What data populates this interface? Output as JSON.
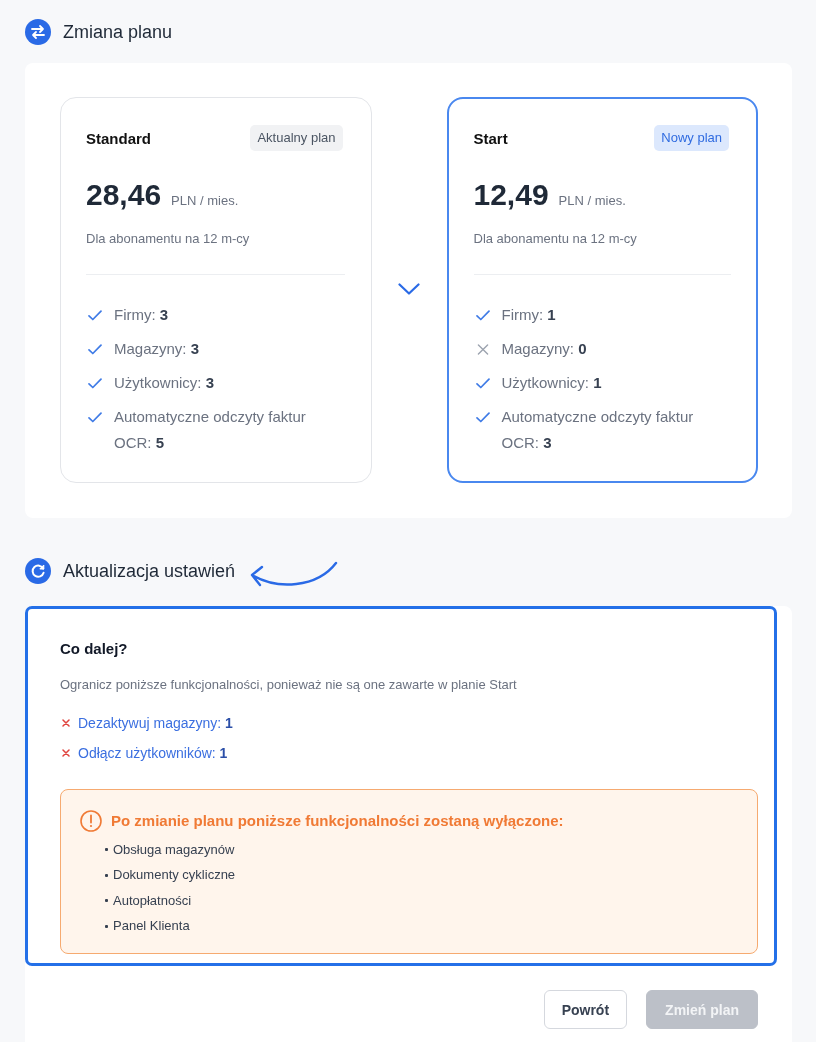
{
  "plan_change": {
    "title": "Zmiana planu",
    "plans": [
      {
        "name": "Standard",
        "badge": "Aktualny plan",
        "selected": false,
        "price": "28,46",
        "unit": "PLN / mies.",
        "note": "Dla abonamentu na 12 m-cy",
        "features": [
          {
            "text": "Firmy: **3**",
            "included": true
          },
          {
            "text": "Magazyny: **3**",
            "included": true
          },
          {
            "text": "Użytkownicy: **3**",
            "included": true
          },
          {
            "text": "Automatyczne odczyty faktur OCR: **5**",
            "included": true
          }
        ]
      },
      {
        "name": "Start",
        "badge": "Nowy plan",
        "selected": true,
        "price": "12,49",
        "unit": "PLN / mies.",
        "note": "Dla abonamentu na 12 m-cy",
        "features": [
          {
            "text": "Firmy: **1**",
            "included": true
          },
          {
            "text": "Magazyny: **0**",
            "included": false
          },
          {
            "text": "Użytkownicy: **1**",
            "included": true
          },
          {
            "text": "Automatyczne odczyty faktur OCR: **3**",
            "included": true
          }
        ]
      }
    ]
  },
  "settings_update": {
    "title": "Aktualizacja ustawień",
    "heading": "Co dalej?",
    "description": "Ogranicz poniższe funkcjonalności, ponieważ nie są one zawarte w planie Start",
    "actions": [
      "Dezaktywuj magazyny: **1**",
      "Odłącz użytkowników: **1**"
    ],
    "warning": {
      "title": "Po zmianie planu poniższe funkcjonalności zostaną wyłączone:",
      "items": [
        "Obsługa magazynów",
        "Dokumenty cykliczne",
        "Autopłatności",
        "Panel Klienta"
      ]
    }
  },
  "buttons": [
    {
      "label": "Powrót",
      "disabled": false
    },
    {
      "label": "Zmień plan",
      "disabled": true
    }
  ]
}
